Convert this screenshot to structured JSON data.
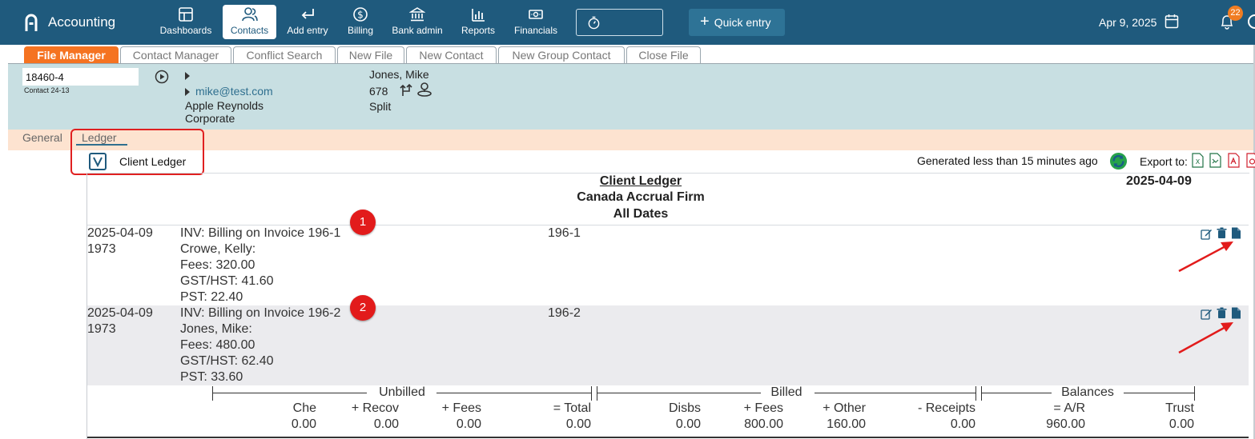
{
  "app": {
    "title": "Accounting"
  },
  "nav": [
    {
      "label": "Dashboards",
      "icon": "dashboard-icon"
    },
    {
      "label": "Contacts",
      "icon": "contacts-icon",
      "active": true
    },
    {
      "label": "Add entry",
      "icon": "add-entry-icon"
    },
    {
      "label": "Billing",
      "icon": "billing-icon"
    },
    {
      "label": "Bank admin",
      "icon": "bank-icon"
    },
    {
      "label": "Reports",
      "icon": "reports-icon"
    },
    {
      "label": "Financials",
      "icon": "financials-icon"
    }
  ],
  "quick_entry": "Quick entry",
  "header_date": "Apr 9, 2025",
  "notifications": "22",
  "tabs": [
    "File Manager",
    "Contact Manager",
    "Conflict Search",
    "New File",
    "New Contact",
    "New Group Contact",
    "Close File"
  ],
  "contact": {
    "file_number": "18460-4",
    "subtitle": "Contact 24-13",
    "email": "mike@test.com",
    "company_line1": "Apple Reynolds",
    "company_line2": "Corporate",
    "person": "Jones, Mike",
    "number": "678",
    "split": "Split"
  },
  "subnav": {
    "general": "General",
    "ledger": "Ledger"
  },
  "client_ledger_label": "Client Ledger",
  "generated": "Generated less than 15 minutes ago",
  "export_label": "Export to:",
  "report": {
    "title": "Client Ledger",
    "firm": "Canada Accrual Firm",
    "range": "All Dates",
    "date": "2025-04-09",
    "rows": [
      {
        "marker": "1",
        "date": "2025-04-09",
        "num": "1973",
        "desc": "INV: Billing on Invoice 196-1",
        "name": "Crowe, Kelly:",
        "fees": "Fees: 320.00",
        "gst": "GST/HST: 41.60",
        "pst": "PST: 22.40",
        "ref": "196-1"
      },
      {
        "marker": "2",
        "date": "2025-04-09",
        "num": "1973",
        "desc": "INV: Billing on Invoice 196-2",
        "name": "Jones, Mike:",
        "fees": "Fees: 480.00",
        "gst": "GST/HST: 62.40",
        "pst": "PST: 33.60",
        "ref": "196-2"
      }
    ],
    "groups": {
      "unbilled": "Unbilled",
      "billed": "Billed",
      "balances": "Balances"
    },
    "totals": [
      {
        "label": "Che",
        "value": "0.00"
      },
      {
        "label": "+ Recov",
        "value": "0.00"
      },
      {
        "label": "+ Fees",
        "value": "0.00"
      },
      {
        "label": "= Total",
        "value": "0.00"
      },
      {
        "label": "Disbs",
        "value": "0.00"
      },
      {
        "label": "+ Fees",
        "value": "800.00"
      },
      {
        "label": "+ Other",
        "value": "160.00"
      },
      {
        "label": "- Receipts",
        "value": "0.00"
      },
      {
        "label": "= A/R",
        "value": "960.00"
      },
      {
        "label": "Trust",
        "value": "0.00"
      }
    ]
  },
  "colors": {
    "nav_bg": "#1f5a7d",
    "tab_active": "#f57321",
    "contact_bg": "#c8dfe2",
    "subnav_bg": "#fde3d0",
    "marker": "#e21b1b"
  }
}
